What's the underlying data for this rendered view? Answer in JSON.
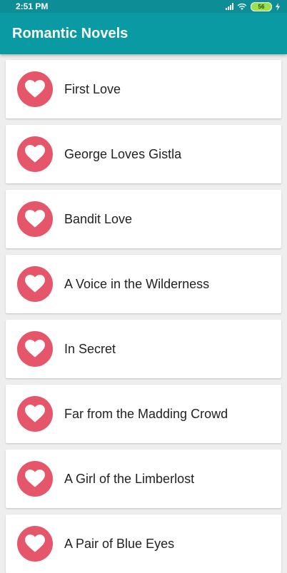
{
  "status_bar": {
    "time": "2:51 PM",
    "battery": "56"
  },
  "app_bar": {
    "title": "Romantic Novels"
  },
  "colors": {
    "app_bar": "#0a9aa3",
    "status_bar": "#0d8e96",
    "heart_badge": "#e5566a",
    "background": "#eeeeee"
  },
  "novels": [
    {
      "title": "First Love",
      "icon": "heart-icon"
    },
    {
      "title": "George Loves Gistla",
      "icon": "heart-icon"
    },
    {
      "title": "Bandit Love",
      "icon": "heart-icon"
    },
    {
      "title": "A Voice in the Wilderness",
      "icon": "heart-icon"
    },
    {
      "title": "In Secret",
      "icon": "heart-icon"
    },
    {
      "title": "Far from the Madding Crowd",
      "icon": "heart-icon"
    },
    {
      "title": "A Girl of the Limberlost",
      "icon": "heart-icon"
    },
    {
      "title": "A Pair of Blue Eyes",
      "icon": "heart-icon"
    }
  ]
}
